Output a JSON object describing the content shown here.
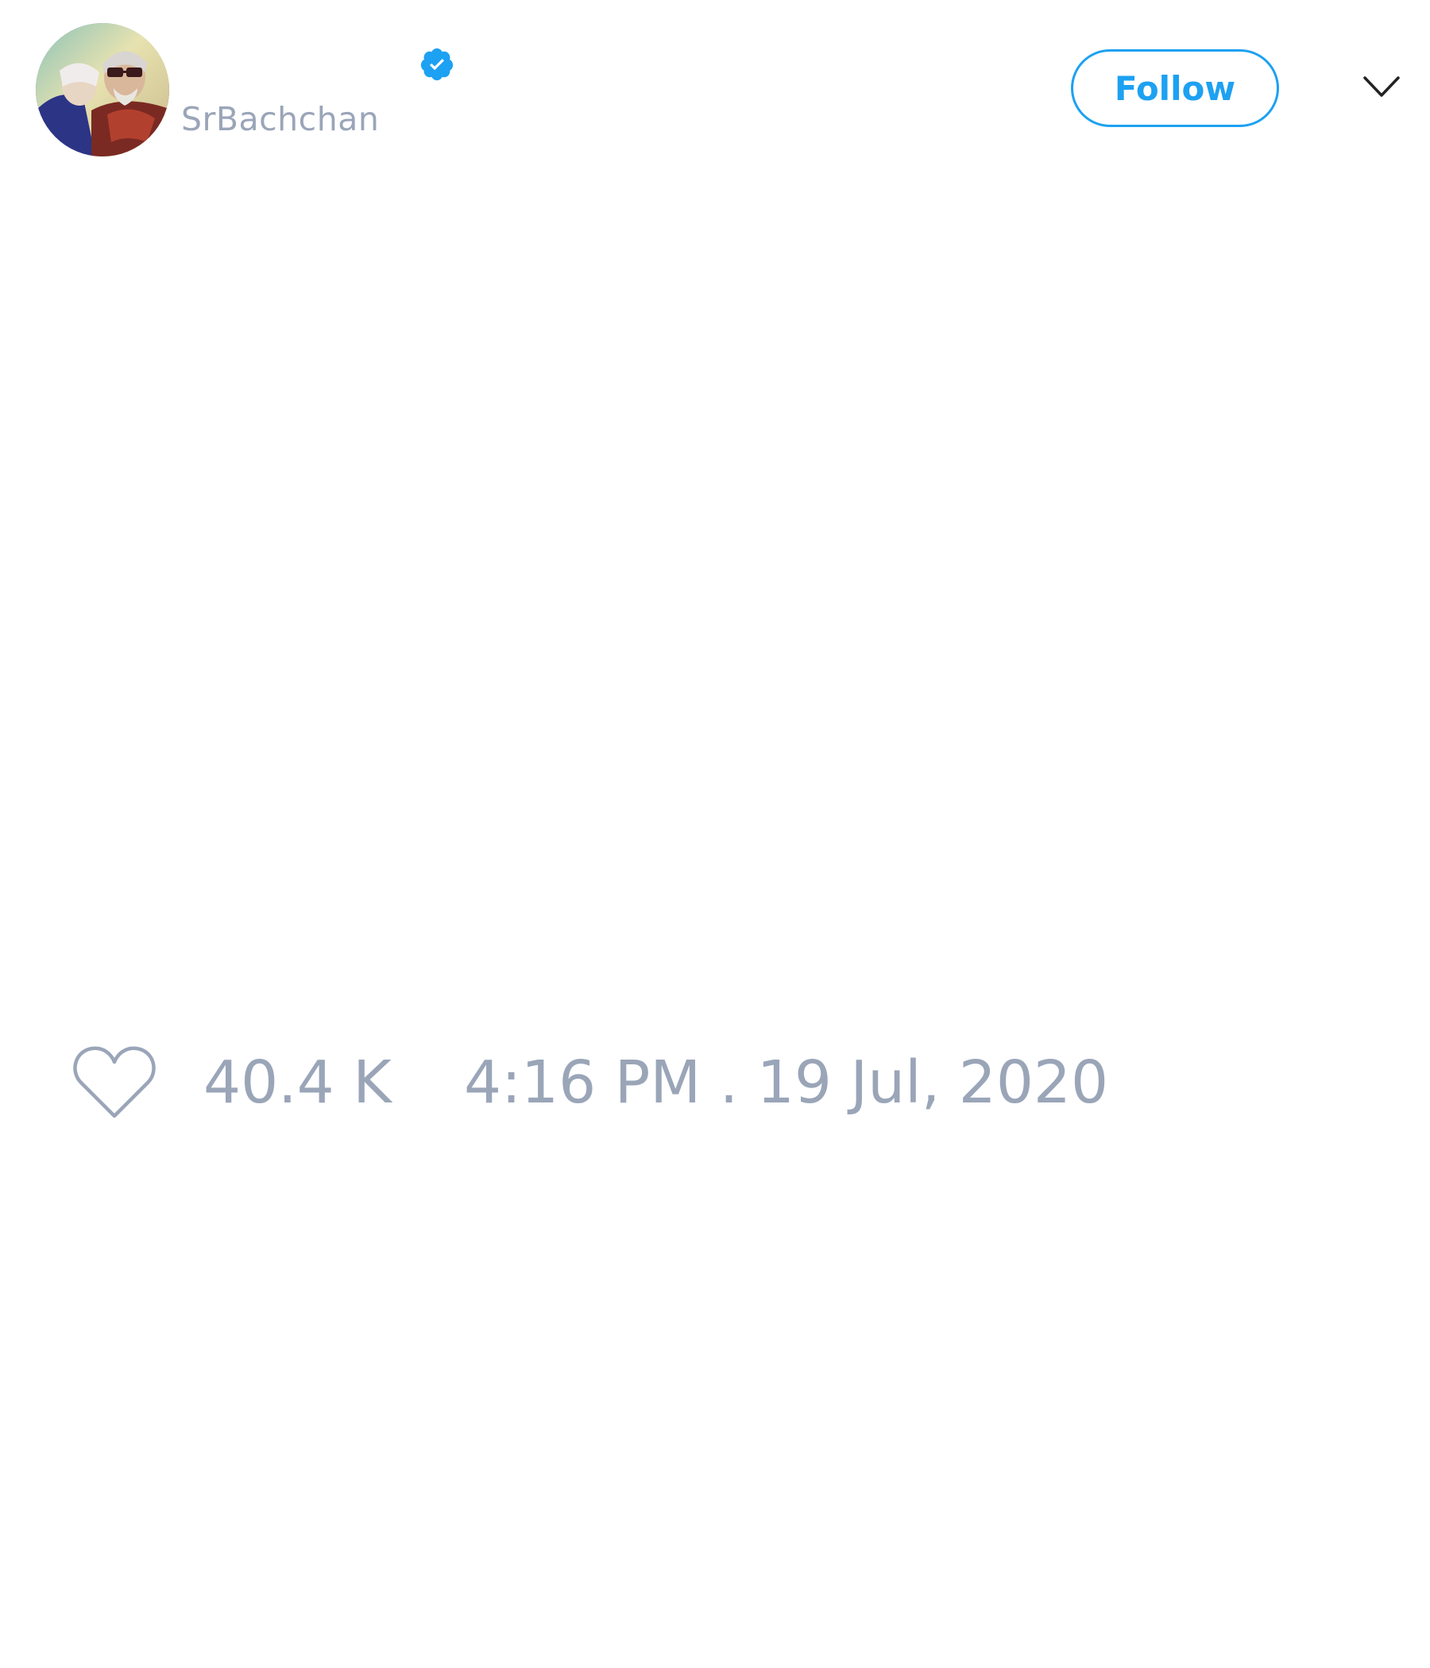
{
  "tweet": {
    "author": {
      "handle": "SrBachchan",
      "verified": true,
      "avatar_icon": "profile-photo"
    },
    "follow_label": "Follow",
    "menu_icon": "chevron-down-icon",
    "likes": {
      "icon": "heart-icon",
      "count": "40.4 K"
    },
    "timestamp": "4:16 PM . 19 Jul, 2020"
  },
  "colors": {
    "accent": "#1da1f2",
    "muted_text": "#9aa5b8",
    "background": "#ffffff"
  }
}
